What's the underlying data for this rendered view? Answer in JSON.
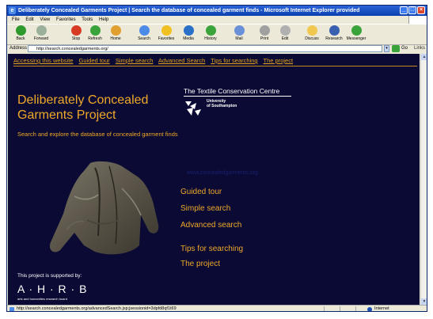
{
  "window": {
    "title": "Deliberately Concealed Garments Project | Search the database of concealed garment finds - Microsoft Internet Explorer provided",
    "buttons": [
      "_",
      "□",
      "×"
    ]
  },
  "menubar": [
    "File",
    "Edit",
    "View",
    "Favorites",
    "Tools",
    "Help"
  ],
  "toolbar": {
    "items": [
      {
        "label": "Back",
        "icon": "back-arrow-icon",
        "color": "#2e9a2e"
      },
      {
        "label": "Forward",
        "icon": "forward-arrow-icon",
        "color": "#9ab09a"
      },
      {
        "label": "Stop",
        "icon": "stop-icon",
        "color": "#d83b24"
      },
      {
        "label": "Refresh",
        "icon": "refresh-icon",
        "color": "#3aa43a"
      },
      {
        "label": "Home",
        "icon": "home-icon",
        "color": "#e0a030"
      },
      {
        "label": "Search",
        "icon": "search-icon",
        "color": "#4c8be8"
      },
      {
        "label": "Favorites",
        "icon": "star-icon",
        "color": "#f0c020"
      },
      {
        "label": "Media",
        "icon": "media-icon",
        "color": "#2a70c8"
      },
      {
        "label": "History",
        "icon": "history-icon",
        "color": "#3aa43a"
      },
      {
        "label": "Mail",
        "icon": "mail-icon",
        "color": "#6a90d8"
      },
      {
        "label": "Print",
        "icon": "print-icon",
        "color": "#a0a0a0"
      },
      {
        "label": "Edit",
        "icon": "edit-icon",
        "color": "#b0b0b0"
      },
      {
        "label": "Discuss",
        "icon": "discuss-icon",
        "color": "#f0c850"
      },
      {
        "label": "Research",
        "icon": "research-icon",
        "color": "#3a60b0"
      },
      {
        "label": "Messenger",
        "icon": "messenger-icon",
        "color": "#3aa43a"
      }
    ]
  },
  "addressbar": {
    "label": "Address",
    "url": "http://search.concealedgarments.org/",
    "go_label": "Go",
    "links_label": "Links »"
  },
  "page": {
    "top_nav": [
      "Accessing this website",
      "Guided tour",
      "Simple search",
      "Advanced Search",
      "Tips for searching",
      "The project"
    ],
    "project_title": "Deliberately Concealed Garments Project",
    "centre_name": "The Textile Conservation Centre",
    "university": [
      "University",
      "of Southampton"
    ],
    "tagline": "Search and explore the database of concealed garment finds",
    "faded_link": "www.concealedgarments.org",
    "main_nav": [
      {
        "label": "Guided tour"
      },
      {
        "label": "Simple search"
      },
      {
        "label": "Advanced search"
      },
      {
        "label": "Tips for searching"
      },
      {
        "label": "The project"
      }
    ],
    "supported_by": "This project is supported by:",
    "ahrb_logo": "A · H · R · B",
    "ahrb_sub": "arts and humanities research board",
    "accent_color": "#f0a828",
    "background_color": "#0a0a34"
  },
  "statusbar": {
    "url": "http://search.concealedgarments.org/advancedSearch.jsp;jsessionid=3dpfd8qf1t69",
    "zone": "Internet"
  }
}
